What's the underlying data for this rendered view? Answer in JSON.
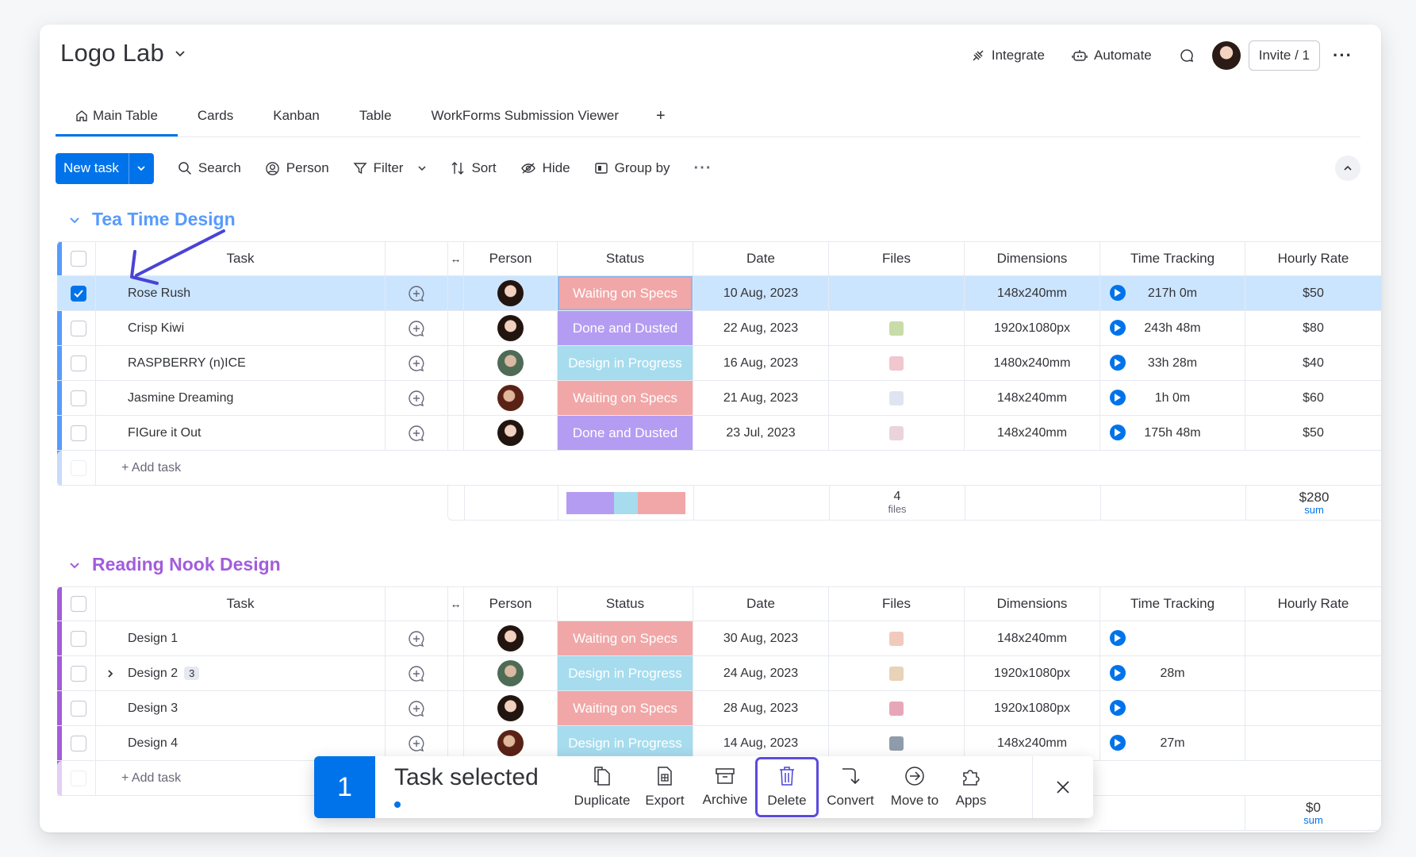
{
  "board": {
    "title": "Logo Lab"
  },
  "header": {
    "integrate": "Integrate",
    "automate": "Automate",
    "invite": "Invite / 1"
  },
  "tabs": [
    {
      "label": "Main Table"
    },
    {
      "label": "Cards"
    },
    {
      "label": "Kanban"
    },
    {
      "label": "Table"
    },
    {
      "label": "WorkForms Submission Viewer"
    },
    {
      "label": "+"
    }
  ],
  "toolbar": {
    "new_task": "New task",
    "search": "Search",
    "person": "Person",
    "filter": "Filter",
    "sort": "Sort",
    "hide": "Hide",
    "group_by": "Group by"
  },
  "columns": [
    "Task",
    "Person",
    "Status",
    "Date",
    "Files",
    "Dimensions",
    "Time Tracking",
    "Hourly Rate"
  ],
  "colors": {
    "accent": "#0073ea",
    "group1": "#579bfc",
    "group2": "#a25ddc",
    "waiting": "#f1a7a7",
    "done": "#b49cf2",
    "progress": "#a6dcee",
    "selected_row": "#cce5ff",
    "highlight": "#5b4ae0"
  },
  "groups": [
    {
      "title": "Tea Time Design",
      "rows": [
        {
          "task": "Rose Rush",
          "status": "Waiting on Specs",
          "date": "10 Aug, 2023",
          "dimensions": "148x240mm",
          "time": "217h 0m",
          "rate": "$50",
          "selected": true
        },
        {
          "task": "Crisp Kiwi",
          "status": "Done and Dusted",
          "date": "22 Aug, 2023",
          "dimensions": "1920x1080px",
          "time": "243h 48m",
          "rate": "$80"
        },
        {
          "task": "RASPBERRY (n)ICE",
          "status": "Design in Progress",
          "date": "16 Aug, 2023",
          "dimensions": "1480x240mm",
          "time": "33h 28m",
          "rate": "$40"
        },
        {
          "task": "Jasmine Dreaming",
          "status": "Waiting on Specs",
          "date": "21 Aug, 2023",
          "dimensions": "148x240mm",
          "time": "1h 0m",
          "rate": "$60"
        },
        {
          "task": "FIGure it Out",
          "status": "Done and Dusted",
          "date": "23 Jul, 2023",
          "dimensions": "148x240mm",
          "time": "175h 48m",
          "rate": "$50"
        }
      ],
      "add_task": "+ Add task",
      "summary": {
        "files_count": "4",
        "files_label": "files",
        "rate_sum": "$280",
        "sum_label": "sum"
      }
    },
    {
      "title": "Reading Nook Design",
      "rows": [
        {
          "task": "Design 1",
          "status": "Waiting on Specs",
          "date": "30 Aug, 2023",
          "dimensions": "148x240mm",
          "time": "",
          "rate": ""
        },
        {
          "task": "Design 2",
          "subitems": "3",
          "status": "Design in Progress",
          "date": "24 Aug, 2023",
          "dimensions": "1920x1080px",
          "time": "28m",
          "rate": ""
        },
        {
          "task": "Design 3",
          "status": "Waiting on Specs",
          "date": "28 Aug, 2023",
          "dimensions": "1920x1080px",
          "time": "",
          "rate": ""
        },
        {
          "task": "Design 4",
          "status": "Design in Progress",
          "date": "14 Aug, 2023",
          "dimensions": "148x240mm",
          "time": "27m",
          "rate": ""
        }
      ],
      "add_task": "+ Add task",
      "summary": {
        "rate_sum": "$0",
        "sum_label": "sum"
      }
    }
  ],
  "selection_bar": {
    "count": "1",
    "label": "Task selected",
    "actions": [
      "Duplicate",
      "Export",
      "Archive",
      "Delete",
      "Convert",
      "Move to",
      "Apps"
    ]
  }
}
